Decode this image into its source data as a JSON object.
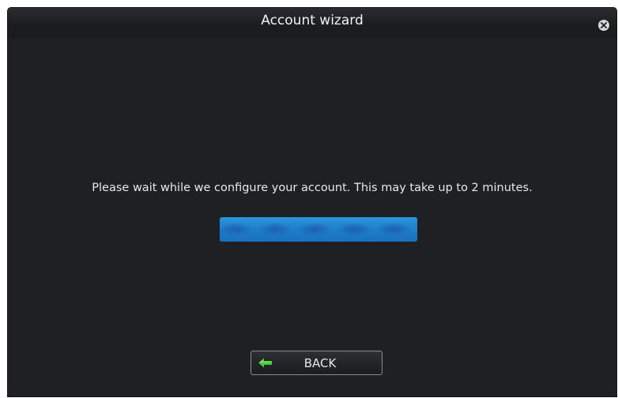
{
  "window": {
    "title": "Account wizard"
  },
  "content": {
    "message": "Please wait while we configure your account. This may take up to 2 minutes.",
    "progress_fraction": 1.0
  },
  "footer": {
    "back_label": "BACK"
  },
  "icons": {
    "close": "close-icon",
    "back": "arrow-left-icon"
  },
  "colors": {
    "background": "#1f2023",
    "progress": "#1f7fca",
    "back_arrow": "#3fcf2f"
  }
}
